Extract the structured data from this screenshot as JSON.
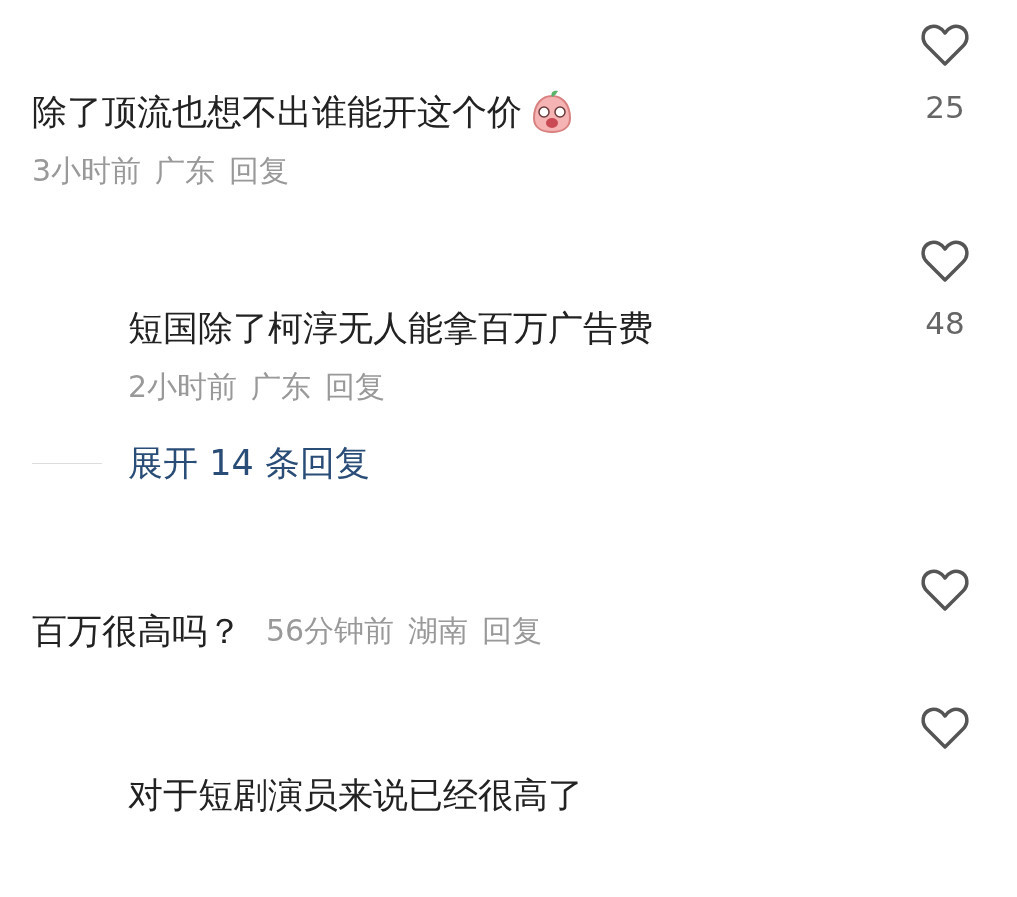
{
  "comments": [
    {
      "kind": "comment",
      "text": "除了顶流也想不出谁能开这个价",
      "emoji": true,
      "meta_inline": false,
      "time": "3小时前",
      "location": "广东",
      "reply": "回复",
      "likes": "25",
      "liked": false
    },
    {
      "kind": "reply",
      "text": "短国除了柯淳无人能拿百万广告费",
      "emoji": false,
      "meta_inline": false,
      "time": "2小时前",
      "location": "广东",
      "reply": "回复",
      "likes": "48",
      "liked": false
    },
    {
      "kind": "expand",
      "text": "展开 14 条回复"
    },
    {
      "kind": "comment",
      "text": "百万很高吗？",
      "emoji": false,
      "meta_inline": true,
      "time": "56分钟前",
      "location": "湖南",
      "reply": "回复",
      "liked": false
    },
    {
      "kind": "reply",
      "text": "对于短剧演员来说已经很高了",
      "emoji": false,
      "meta_inline": false,
      "liked": false
    }
  ]
}
